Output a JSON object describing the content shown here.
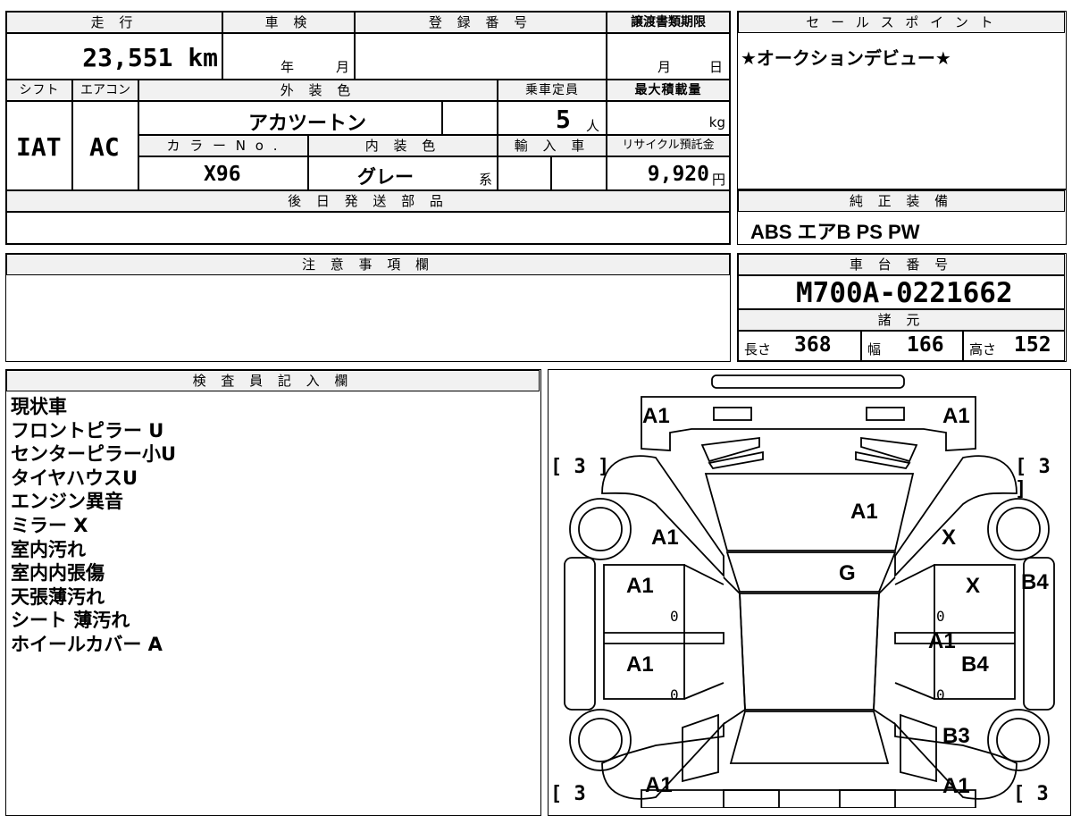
{
  "top_table": {
    "mileage_label": "走 行",
    "mileage_value": "23,551 km",
    "shaken_label": "車 検",
    "shaken_year": "年",
    "shaken_month": "月",
    "reg_label": "登 録 番 号",
    "transfer_label": "譲渡書類期限",
    "transfer_month": "月",
    "transfer_day": "日",
    "shift_label": "シフト",
    "ac_label": "エアコン",
    "exterior_label": "外 装 色",
    "capacity_label": "乗車定員",
    "maxload_label": "最大積載量",
    "shift_value": "IAT",
    "ac_value": "AC",
    "exterior_value": "アカツートン",
    "capacity_value": "5",
    "capacity_unit": "人",
    "load_unit": "kg",
    "color_no_label": "カ ラ ー N o .",
    "interior_label": "内 装 色",
    "import_label": "輸 入 車",
    "recycle_label": "リサイクル預託金",
    "color_no_value": "X96",
    "interior_value": "グレー",
    "interior_suffix": "系",
    "recycle_value": "9,920",
    "recycle_unit": "円",
    "later_parts_label": "後 日 発 送 部 品"
  },
  "sales_point": {
    "label": "セ ー ル ス ポ イ ン ト",
    "text": "★オークションデビュー★"
  },
  "genuine_equipment": {
    "label": "純 正 装 備",
    "value": "ABS エアB PS PW"
  },
  "notes": {
    "label": "注 意 事 項 欄"
  },
  "chassis": {
    "label": "車 台 番 号",
    "value": "M700A-0221662",
    "spec_label": "諸 元",
    "length_label": "長さ",
    "length_value": "368",
    "width_label": "幅",
    "width_value": "166",
    "height_label": "高さ",
    "height_value": "152"
  },
  "inspector": {
    "label": "検 査 員 記 入 欄",
    "lines": [
      "現状車",
      "フロントピラー U",
      "センターピラー小U",
      "タイヤハウスU",
      "エンジン異音",
      "ミラー X",
      "室内汚れ",
      "室内内張傷",
      "天張薄汚れ",
      "シート 薄汚れ",
      "ホイールカバー A"
    ]
  },
  "diagram": {
    "marks": [
      "A1",
      "A1",
      "A1",
      "A1",
      "X",
      "G",
      "A1",
      "X",
      "B4",
      "A1",
      "A1",
      "B4",
      "A1",
      "B3",
      "A1",
      "A1"
    ],
    "zeros": [
      "0",
      "0",
      "0",
      "0"
    ],
    "brackets": [
      "[ 3 ]",
      "[ 3 ]",
      "[ 3",
      "[ 3"
    ]
  }
}
